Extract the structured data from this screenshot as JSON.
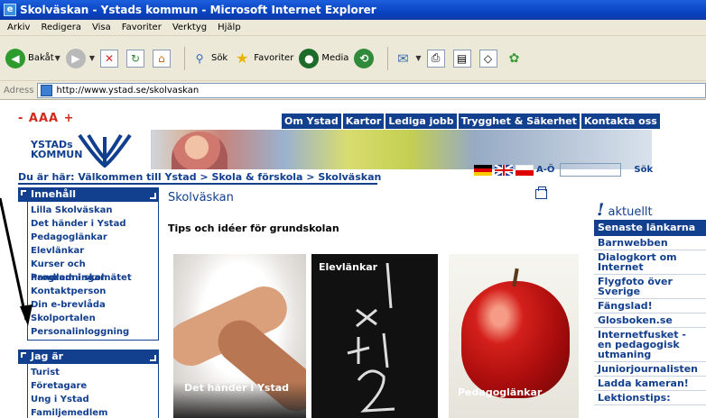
{
  "window": {
    "title": "Skolväskan - Ystads kommun - Microsoft Internet Explorer"
  },
  "menu": [
    "Arkiv",
    "Redigera",
    "Visa",
    "Favoriter",
    "Verktyg",
    "Hjälp"
  ],
  "toolbar": {
    "back": "Bakåt",
    "search": "Sök",
    "favorites": "Favoriter",
    "media": "Media"
  },
  "address": {
    "label": "Adress",
    "url": "http://www.ystad.se/skolvaskan"
  },
  "page": {
    "text_size": "- AAA +",
    "top_nav": [
      "Om Ystad",
      "Kartor",
      "Lediga jobb",
      "Trygghet & Säkerhet",
      "Kontakta oss"
    ],
    "logo": {
      "line1": "YSTADs",
      "line2": "KOMMUN"
    },
    "breadcrumb": "Du är här: Välkommen till Ystad > Skola & förskola > Skolväskan",
    "a_o": "A-Ö",
    "search_button": "Sök",
    "innehall": {
      "heading": "Innehåll",
      "items": [
        "Lilla Skolväskan",
        "Det händer i Ystad",
        "Pedagoglänkar",
        "Elevlänkar",
        "Kurser och handledningar",
        "Program i skolnätet",
        "Kontaktperson",
        "Din e-brevlåda",
        "Skolportalen",
        "Personalinloggning"
      ]
    },
    "jag_ar": {
      "heading": "Jag är",
      "items": [
        "Turist",
        "Företagare",
        "Ung i Ystad",
        "Familjemedlem"
      ]
    },
    "title": "Skolväskan",
    "subtitle": "Tips och idéer för grundskolan",
    "tiles": [
      {
        "caption": "Det händer i Ystad"
      },
      {
        "caption": "Elevlänkar"
      },
      {
        "caption": "Pedagoglänkar"
      }
    ],
    "aktuellt": {
      "bang": "!",
      "label": "aktuellt"
    },
    "right": {
      "heading": "Senaste länkarna",
      "items": [
        "Barnwebben",
        "Dialogkort om Internet",
        "Flygfoto över Sverige",
        "Fängslad!",
        "Glosboken.se",
        "Internetfusket - en pedagogisk utmaning",
        "Juniorjournalisten",
        "Ladda kameran!",
        "Lektionstips:"
      ]
    }
  },
  "colors": {
    "brand": "#123f8e",
    "textsize": "#d12a1a",
    "titlebar": "#0a43c2"
  }
}
